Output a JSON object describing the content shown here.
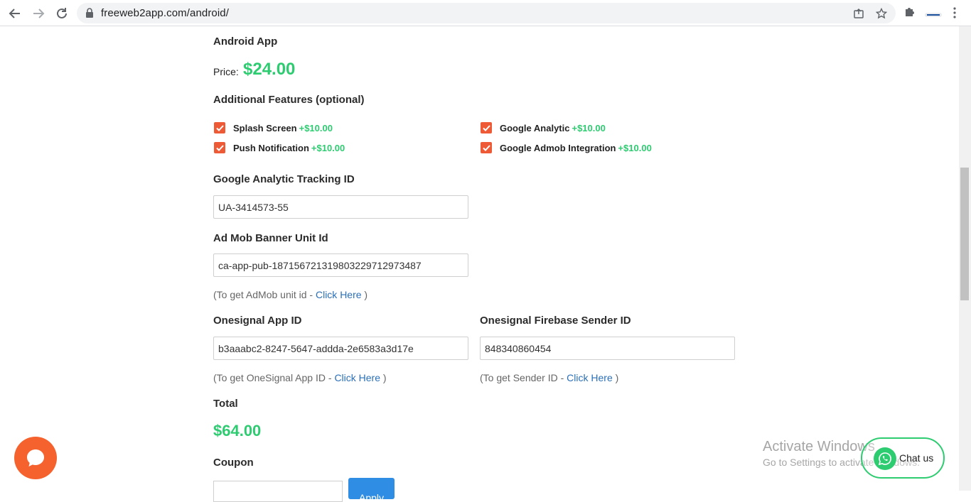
{
  "browser": {
    "url": "freeweb2app.com/android/"
  },
  "product": {
    "title": "Android App",
    "price_label": "Price:",
    "price_value": "$24.00"
  },
  "features": {
    "heading": "Additional Features (optional)",
    "items": [
      {
        "label": "Splash Screen",
        "price": "+$10.00",
        "checked": true
      },
      {
        "label": "Google Analytic",
        "price": "+$10.00",
        "checked": true
      },
      {
        "label": "Push Notification",
        "price": "+$10.00",
        "checked": true
      },
      {
        "label": "Google Admob Integration",
        "price": "+$10.00",
        "checked": true
      }
    ]
  },
  "fields": {
    "analytics_label": "Google Analytic Tracking ID",
    "analytics_value": "UA-3414573-55",
    "admob_label": "Ad Mob Banner Unit Id",
    "admob_value": "ca-app-pub-18715672131980322971297348​7",
    "admob_hint_prefix": "(To get AdMob unit id - ",
    "admob_hint_link": "Click Here",
    "admob_hint_suffix": " )",
    "onesignal_label": "Onesignal App ID",
    "onesignal_value": "b3aaabc2-8247-5647-addda-2e6583a3d17e",
    "onesignal_hint_prefix": "(To get OneSignal App ID - ",
    "onesignal_hint_link": "Click Here",
    "onesignal_hint_suffix": " )",
    "sender_label": "Onesignal Firebase Sender ID",
    "sender_value": "848340860454",
    "sender_hint_prefix": "(To get Sender ID - ",
    "sender_hint_link": "Click Here",
    "sender_hint_suffix": " )"
  },
  "total": {
    "label": "Total",
    "value": "$64.00"
  },
  "coupon": {
    "label": "Coupon",
    "apply": "Apply"
  },
  "overlay": {
    "activate_title": "Activate Windows",
    "activate_sub": "Go to Settings to activate Windows.",
    "chat_label": "Chat us"
  },
  "colors": {
    "accent_green": "#2ecc71",
    "checkbox": "#ee5a36",
    "link": "#2a6fb8",
    "chat_bubble": "#f5622d"
  }
}
